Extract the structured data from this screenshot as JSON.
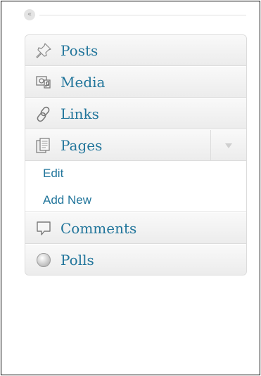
{
  "collapse": {
    "glyph": "«"
  },
  "menu": {
    "items": [
      {
        "label": "Posts",
        "icon": "pushpin-icon"
      },
      {
        "label": "Media",
        "icon": "media-icon"
      },
      {
        "label": "Links",
        "icon": "link-chain-icon"
      },
      {
        "label": "Pages",
        "icon": "pages-icon",
        "expanded": true,
        "submenu": [
          {
            "label": "Edit"
          },
          {
            "label": "Add New"
          }
        ]
      },
      {
        "label": "Comments",
        "icon": "speech-bubble-icon"
      },
      {
        "label": "Polls",
        "icon": "circle-icon"
      }
    ]
  },
  "colors": {
    "link": "#21759b",
    "menu_bg": "#f1f1f1",
    "border": "#dcdcdc"
  }
}
